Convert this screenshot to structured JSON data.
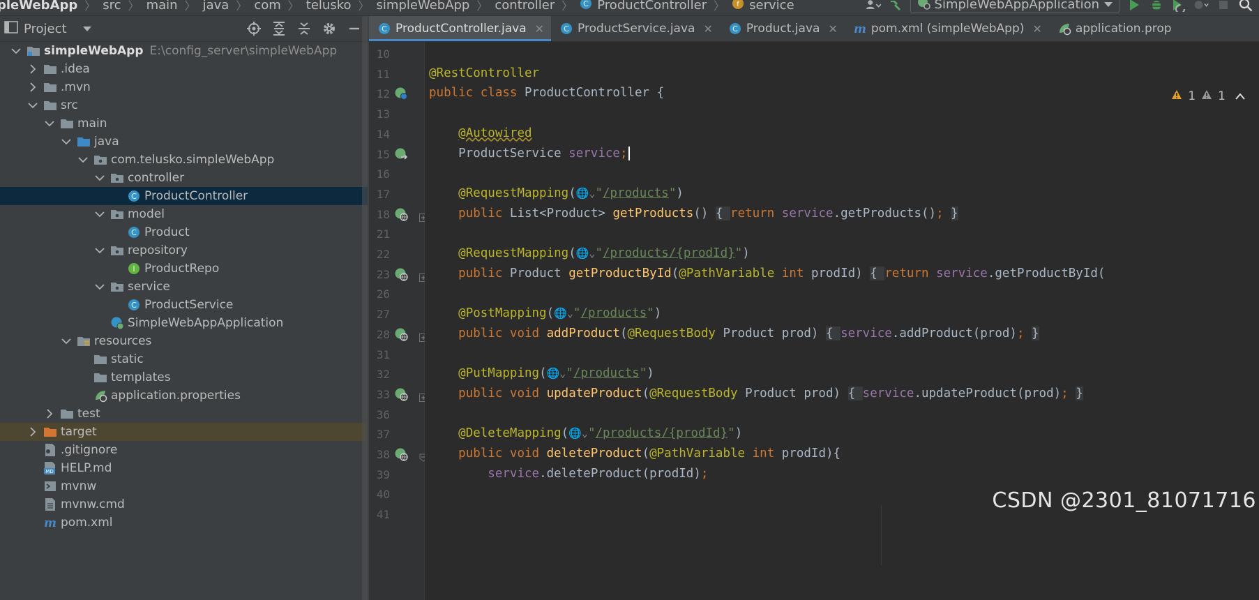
{
  "breadcrumb": {
    "items": [
      "pleWebApp",
      "src",
      "main",
      "java",
      "com",
      "telusko",
      "simpleWebApp",
      "controller",
      "ProductController",
      "service"
    ]
  },
  "toolbar": {
    "run_config": "SimpleWebAppApplication"
  },
  "project_panel": {
    "title": "Project",
    "tree": [
      {
        "label": "simpleWebApp",
        "path": "E:\\config_server\\simpleWebApp",
        "depth": 0,
        "chevron": "down",
        "icon": "module-folder-icon",
        "bold": true
      },
      {
        "label": ".idea",
        "depth": 1,
        "chevron": "right",
        "icon": "folder-icon"
      },
      {
        "label": ".mvn",
        "depth": 1,
        "chevron": "right",
        "icon": "folder-icon"
      },
      {
        "label": "src",
        "depth": 1,
        "chevron": "down",
        "icon": "folder-icon"
      },
      {
        "label": "main",
        "depth": 2,
        "chevron": "down",
        "icon": "folder-icon"
      },
      {
        "label": "java",
        "depth": 3,
        "chevron": "down",
        "icon": "source-folder-icon"
      },
      {
        "label": "com.telusko.simpleWebApp",
        "depth": 4,
        "chevron": "down",
        "icon": "package-icon"
      },
      {
        "label": "controller",
        "depth": 5,
        "chevron": "down",
        "icon": "package-icon"
      },
      {
        "label": "ProductController",
        "depth": 6,
        "chevron": "none",
        "icon": "class-icon",
        "selected": true
      },
      {
        "label": "model",
        "depth": 5,
        "chevron": "down",
        "icon": "package-icon"
      },
      {
        "label": "Product",
        "depth": 6,
        "chevron": "none",
        "icon": "class-icon"
      },
      {
        "label": "repository",
        "depth": 5,
        "chevron": "down",
        "icon": "package-icon"
      },
      {
        "label": "ProductRepo",
        "depth": 6,
        "chevron": "none",
        "icon": "interface-icon"
      },
      {
        "label": "service",
        "depth": 5,
        "chevron": "down",
        "icon": "package-icon"
      },
      {
        "label": "ProductService",
        "depth": 6,
        "chevron": "none",
        "icon": "class-icon"
      },
      {
        "label": "SimpleWebAppApplication",
        "depth": 5,
        "chevron": "none",
        "icon": "spring-app-icon"
      },
      {
        "label": "resources",
        "depth": 3,
        "chevron": "down",
        "icon": "resources-folder-icon"
      },
      {
        "label": "static",
        "depth": 4,
        "chevron": "none",
        "icon": "folder-icon"
      },
      {
        "label": "templates",
        "depth": 4,
        "chevron": "none",
        "icon": "folder-icon"
      },
      {
        "label": "application.properties",
        "depth": 4,
        "chevron": "none",
        "icon": "spring-properties-icon"
      },
      {
        "label": "test",
        "depth": 2,
        "chevron": "right",
        "icon": "folder-icon"
      },
      {
        "label": "target",
        "depth": 1,
        "chevron": "right",
        "icon": "excluded-folder-icon",
        "highlight": true
      },
      {
        "label": ".gitignore",
        "depth": 1,
        "chevron": "none",
        "icon": "ignore-file-icon"
      },
      {
        "label": "HELP.md",
        "depth": 1,
        "chevron": "none",
        "icon": "markdown-icon"
      },
      {
        "label": "mvnw",
        "depth": 1,
        "chevron": "none",
        "icon": "shell-icon"
      },
      {
        "label": "mvnw.cmd",
        "depth": 1,
        "chevron": "none",
        "icon": "text-file-icon"
      },
      {
        "label": "pom.xml",
        "depth": 1,
        "chevron": "none",
        "icon": "maven-icon"
      }
    ]
  },
  "tabs": [
    {
      "label": "ProductController.java",
      "icon": "class-icon",
      "active": true
    },
    {
      "label": "ProductService.java",
      "icon": "class-icon"
    },
    {
      "label": "Product.java",
      "icon": "class-icon"
    },
    {
      "label": "pom.xml (simpleWebApp)",
      "icon": "maven-icon"
    },
    {
      "label": "application.prop",
      "icon": "spring-properties-icon"
    }
  ],
  "inspection": {
    "warnings": "1",
    "weak_warnings": "1"
  },
  "editor": {
    "lines": [
      {
        "n": "10",
        "gutter": null,
        "fold": null,
        "tokens": []
      },
      {
        "n": "11",
        "gutter": null,
        "fold": null,
        "tokens": [
          [
            "an",
            "@RestController"
          ]
        ]
      },
      {
        "n": "12",
        "gutter": "bean",
        "fold": null,
        "tokens": [
          [
            "kw",
            "public class "
          ],
          [
            "p",
            "ProductController {"
          ]
        ]
      },
      {
        "n": "13",
        "gutter": null,
        "fold": null,
        "tokens": []
      },
      {
        "n": "14",
        "gutter": null,
        "fold": null,
        "tokens": [
          [
            "p",
            "    "
          ],
          [
            "an sq",
            "@Autowired"
          ]
        ]
      },
      {
        "n": "15",
        "gutter": "inject",
        "fold": null,
        "tokens": [
          [
            "p",
            "    ProductService "
          ],
          [
            "fld",
            "service"
          ],
          [
            "kw",
            ";"
          ],
          [
            "caret",
            ""
          ]
        ]
      },
      {
        "n": "16",
        "gutter": null,
        "fold": null,
        "tokens": []
      },
      {
        "n": "17",
        "gutter": null,
        "fold": null,
        "tokens": [
          [
            "p",
            "    "
          ],
          [
            "an",
            "@RequestMapping"
          ],
          [
            "p",
            "("
          ],
          [
            "globe",
            "🌐⌄"
          ],
          [
            "str",
            "\""
          ],
          [
            "url",
            "/products"
          ],
          [
            "str",
            "\""
          ],
          [
            "p",
            ")"
          ]
        ]
      },
      {
        "n": "18",
        "gutter": "web",
        "fold": "plus",
        "tokens": [
          [
            "p",
            "    "
          ],
          [
            "kw",
            "public "
          ],
          [
            "p",
            "List<Product> "
          ],
          [
            "fn",
            "getProducts"
          ],
          [
            "p",
            "() "
          ],
          [
            "blk",
            "{ "
          ],
          [
            "kw",
            "return "
          ],
          [
            "fld",
            "service"
          ],
          [
            "p",
            ".getProducts()"
          ],
          [
            "kw",
            "; "
          ],
          [
            "blk",
            "}"
          ]
        ]
      },
      {
        "n": "21",
        "gutter": null,
        "fold": null,
        "tokens": []
      },
      {
        "n": "22",
        "gutter": null,
        "fold": null,
        "tokens": [
          [
            "p",
            "    "
          ],
          [
            "an",
            "@RequestMapping"
          ],
          [
            "p",
            "("
          ],
          [
            "globe",
            "🌐⌄"
          ],
          [
            "str",
            "\""
          ],
          [
            "url",
            "/products/{prodId}"
          ],
          [
            "str",
            "\""
          ],
          [
            "p",
            ")"
          ]
        ]
      },
      {
        "n": "23",
        "gutter": "web",
        "fold": "plus",
        "tokens": [
          [
            "p",
            "    "
          ],
          [
            "kw",
            "public "
          ],
          [
            "p",
            "Product "
          ],
          [
            "fn",
            "getProductById"
          ],
          [
            "p",
            "("
          ],
          [
            "an",
            "@PathVariable "
          ],
          [
            "kw",
            "int "
          ],
          [
            "p",
            "prodId) "
          ],
          [
            "blk",
            "{ "
          ],
          [
            "kw",
            "return "
          ],
          [
            "fld",
            "service"
          ],
          [
            "p",
            ".getProductById("
          ]
        ]
      },
      {
        "n": "26",
        "gutter": null,
        "fold": null,
        "tokens": []
      },
      {
        "n": "27",
        "gutter": null,
        "fold": null,
        "tokens": [
          [
            "p",
            "    "
          ],
          [
            "an",
            "@PostMapping"
          ],
          [
            "p",
            "("
          ],
          [
            "globe",
            "🌐⌄"
          ],
          [
            "str",
            "\""
          ],
          [
            "url",
            "/products"
          ],
          [
            "str",
            "\""
          ],
          [
            "p",
            ")"
          ]
        ]
      },
      {
        "n": "28",
        "gutter": "web",
        "fold": "plus",
        "tokens": [
          [
            "p",
            "    "
          ],
          [
            "kw",
            "public void "
          ],
          [
            "fn",
            "addProduct"
          ],
          [
            "p",
            "("
          ],
          [
            "an",
            "@RequestBody "
          ],
          [
            "p",
            "Product prod) "
          ],
          [
            "blk",
            "{ "
          ],
          [
            "fld",
            "service"
          ],
          [
            "p",
            ".addProduct(prod)"
          ],
          [
            "kw",
            "; "
          ],
          [
            "blk",
            "}"
          ]
        ]
      },
      {
        "n": "31",
        "gutter": null,
        "fold": null,
        "tokens": []
      },
      {
        "n": "32",
        "gutter": null,
        "fold": null,
        "tokens": [
          [
            "p",
            "    "
          ],
          [
            "an",
            "@PutMapping"
          ],
          [
            "p",
            "("
          ],
          [
            "globe",
            "🌐⌄"
          ],
          [
            "str",
            "\""
          ],
          [
            "url",
            "/products"
          ],
          [
            "str",
            "\""
          ],
          [
            "p",
            ")"
          ]
        ]
      },
      {
        "n": "33",
        "gutter": "web",
        "fold": "plus",
        "tokens": [
          [
            "p",
            "    "
          ],
          [
            "kw",
            "public void "
          ],
          [
            "fn",
            "updateProduct"
          ],
          [
            "p",
            "("
          ],
          [
            "an",
            "@RequestBody "
          ],
          [
            "p",
            "Product prod) "
          ],
          [
            "blk",
            "{ "
          ],
          [
            "fld",
            "service"
          ],
          [
            "p",
            ".updateProduct(prod)"
          ],
          [
            "kw",
            "; "
          ],
          [
            "blk",
            "}"
          ]
        ]
      },
      {
        "n": "36",
        "gutter": null,
        "fold": null,
        "tokens": []
      },
      {
        "n": "37",
        "gutter": null,
        "fold": null,
        "tokens": [
          [
            "p",
            "    "
          ],
          [
            "an",
            "@DeleteMapping"
          ],
          [
            "p",
            "("
          ],
          [
            "globe",
            "🌐⌄"
          ],
          [
            "str",
            "\""
          ],
          [
            "url",
            "/products/{prodId}"
          ],
          [
            "str",
            "\""
          ],
          [
            "p",
            ")"
          ]
        ]
      },
      {
        "n": "38",
        "gutter": "web",
        "fold": "minus",
        "tokens": [
          [
            "p",
            "    "
          ],
          [
            "kw",
            "public void "
          ],
          [
            "fn",
            "deleteProduct"
          ],
          [
            "p",
            "("
          ],
          [
            "an",
            "@PathVariable "
          ],
          [
            "kw",
            "int "
          ],
          [
            "p",
            "prodId){"
          ]
        ]
      },
      {
        "n": "39",
        "gutter": null,
        "fold": null,
        "tokens": [
          [
            "p",
            "        "
          ],
          [
            "fld",
            "service"
          ],
          [
            "p",
            ".deleteProduct(prodId)"
          ],
          [
            "kw",
            ";"
          ]
        ]
      },
      {
        "n": "40",
        "gutter": null,
        "fold": null,
        "tokens": []
      },
      {
        "n": "41",
        "gutter": null,
        "fold": null,
        "tokens": []
      }
    ]
  },
  "watermark": "CSDN @2301_81071716",
  "colors": {
    "editor_bg": "#2b2b2b",
    "panel_bg": "#3c3f41",
    "selection": "#0d293e",
    "tab_underline": "#4a88c7",
    "keyword": "#cc7832",
    "annotation": "#bbb529",
    "method": "#ffc66d",
    "field": "#9876aa",
    "string": "#6a8759"
  }
}
